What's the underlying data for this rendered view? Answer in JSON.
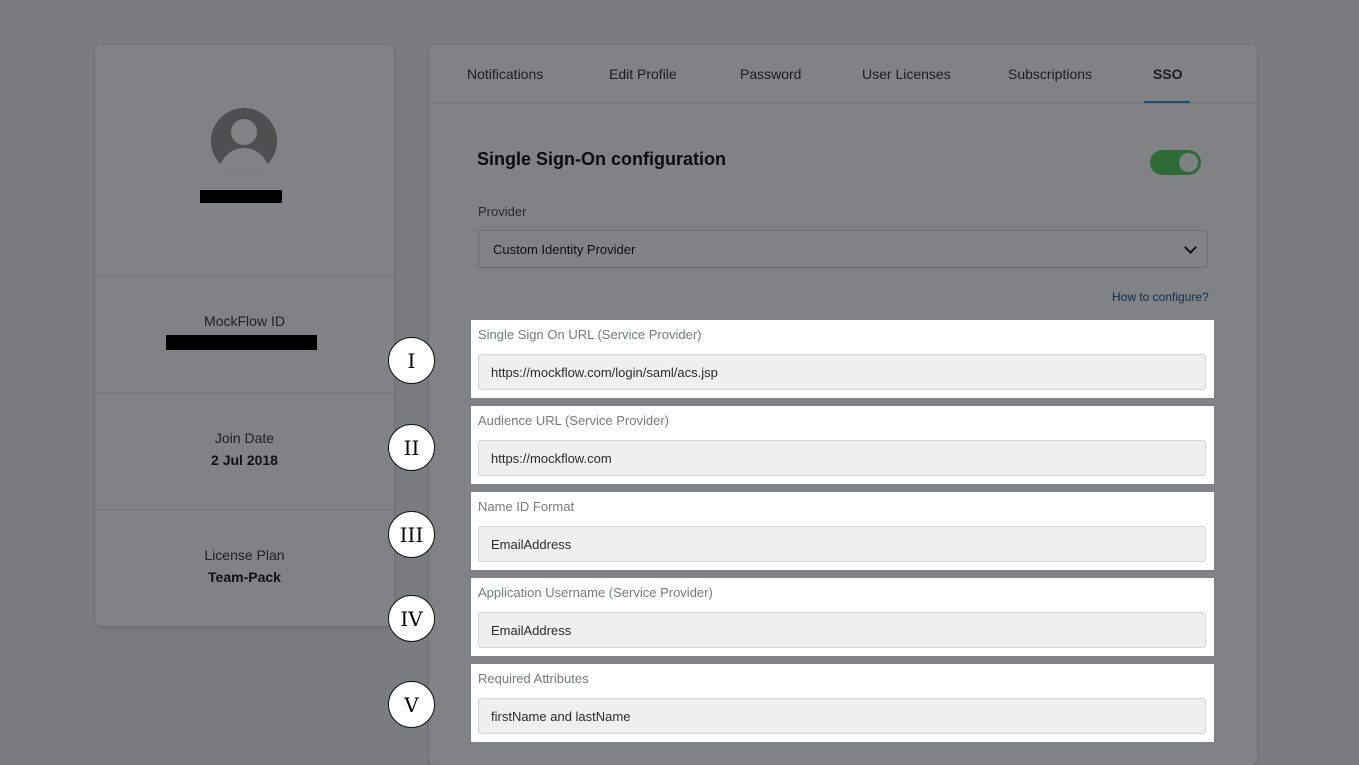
{
  "profile": {
    "mockflow_id_label": "MockFlow ID",
    "join_date_label": "Join Date",
    "join_date_value": "2 Jul 2018",
    "license_plan_label": "License Plan",
    "license_plan_value": "Team-Pack"
  },
  "tabs": [
    {
      "label": "Notifications",
      "active": false
    },
    {
      "label": "Edit Profile",
      "active": false
    },
    {
      "label": "Password",
      "active": false
    },
    {
      "label": "User Licenses",
      "active": false
    },
    {
      "label": "Subscriptions",
      "active": false
    },
    {
      "label": "SSO",
      "active": true
    }
  ],
  "sso": {
    "title": "Single Sign-On configuration",
    "enabled": true,
    "provider_label": "Provider",
    "provider_value": "Custom Identity Provider",
    "how_to_link": "How to configure?"
  },
  "fields": [
    {
      "marker": "I",
      "label": "Single Sign On URL (Service Provider)",
      "value": "https://mockflow.com/login/saml/acs.jsp"
    },
    {
      "marker": "II",
      "label": "Audience URL (Service Provider)",
      "value": "https://mockflow.com"
    },
    {
      "marker": "III",
      "label": "Name ID Format",
      "value": "EmailAddress"
    },
    {
      "marker": "IV",
      "label": "Application Username (Service Provider)",
      "value": "EmailAddress"
    },
    {
      "marker": "V",
      "label": "Required Attributes",
      "value": "firstName and lastName"
    }
  ],
  "colors": {
    "overlay": "#7a7c7f",
    "toggle_on": "#2e6b37",
    "active_tab_underline": "#1d4e73",
    "link": "#0d2f52",
    "highlight_panel": "#ffffff"
  }
}
